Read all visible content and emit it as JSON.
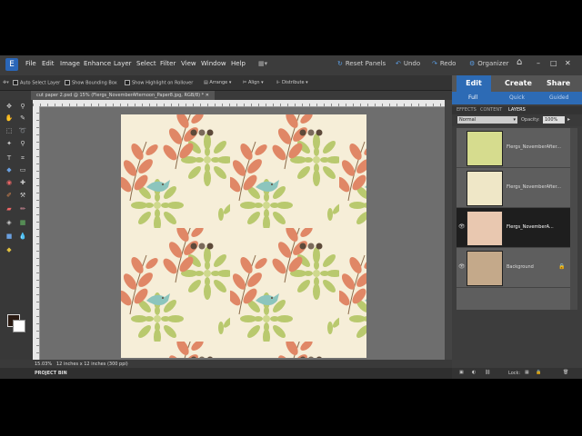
{
  "menubar": {
    "logo": "E",
    "items": [
      "File",
      "Edit",
      "Image",
      "Enhance",
      "Layer",
      "Select",
      "Filter",
      "View",
      "Window",
      "Help"
    ],
    "reset_panels": "Reset Panels",
    "undo": "Undo",
    "redo": "Redo",
    "organizer": "Organizer",
    "icons": [
      "arrange-icon",
      "home-icon"
    ]
  },
  "options": {
    "auto_select": "Auto Select Layer",
    "bounding_box": "Show Bounding Box",
    "highlight": "Show Highlight on Rollover",
    "arrange": "Arrange",
    "align": "Align",
    "distribute": "Distribute"
  },
  "document": {
    "tab_title": "cut paper 2.psd @ 15% (Flergs_NovemberAfternoon_Paper8.jpg, RGB/8) *",
    "zoom": "15.03%",
    "doc_size": "12 inches x 12 inches (300 ppi)"
  },
  "project_bin": "PROJECT BIN",
  "modes": {
    "edit": "Edit",
    "create": "Create",
    "share": "Share",
    "full": "Full",
    "quick": "Quick",
    "guided": "Guided"
  },
  "panel_tabs": [
    "EFFECTS",
    "CONTENT",
    "LAYERS"
  ],
  "layer_controls": {
    "blend_mode": "Normal",
    "opacity_label": "Opacity:",
    "opacity": "100%"
  },
  "layers": [
    {
      "name": "Flergs_NovemberAfter...",
      "thumb_color": "#d6dc8e"
    },
    {
      "name": "Flergs_NovemberAfter...",
      "thumb_color": "#efe7c7"
    },
    {
      "name": "Flergs_NovemberA...",
      "thumb_color": "#e9c8b0",
      "selected": true
    },
    {
      "name": "Background",
      "thumb_color": "#c4a98a"
    }
  ],
  "lock_label": "Lock:",
  "colors": {
    "accent": "#2d6bb5",
    "canvas_bg": "#f6eed8",
    "leaf_orange": "#e08766",
    "leaf_green": "#b9c96e",
    "bird_teal": "#8cc5bd",
    "dot_dark": "#5d4a3a"
  }
}
